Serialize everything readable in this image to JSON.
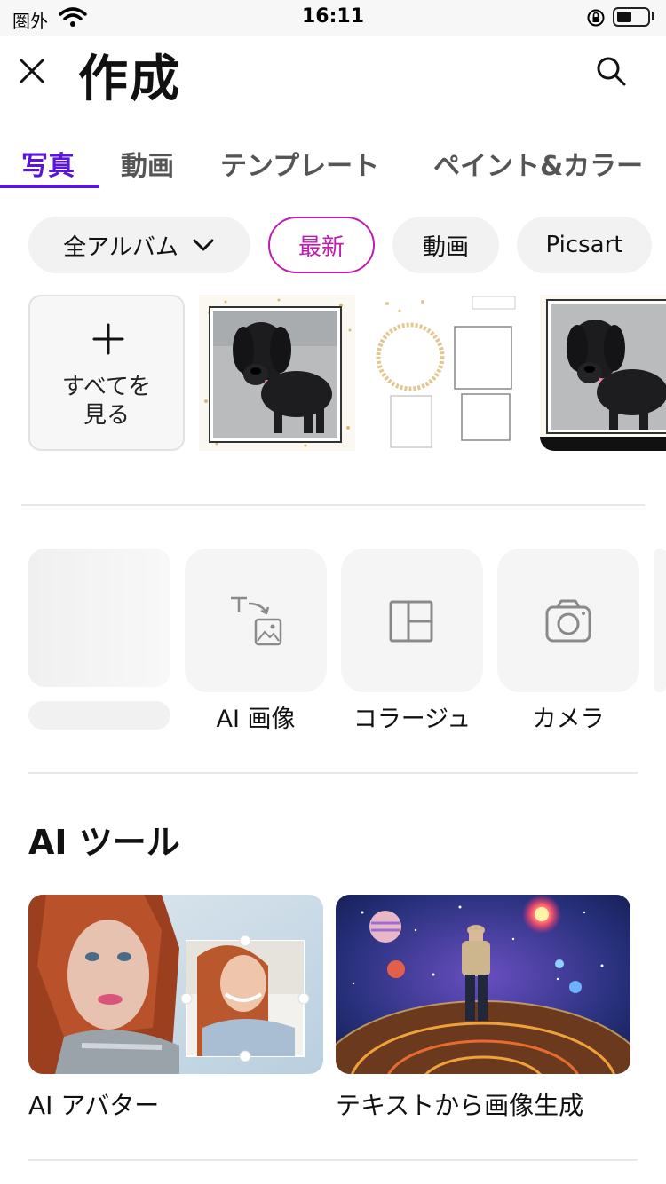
{
  "status": {
    "carrier": "圏外",
    "time": "16:11"
  },
  "header": {
    "title": "作成",
    "close_icon": "close-icon",
    "search_icon": "search-icon"
  },
  "tabs": [
    {
      "label": "写真",
      "active": true
    },
    {
      "label": "動画",
      "active": false
    },
    {
      "label": "テンプレート",
      "active": false
    },
    {
      "label": "ペイント&カラー",
      "active": false
    }
  ],
  "filters": [
    {
      "label": "全アルバム",
      "has_chevron": true,
      "selected": false
    },
    {
      "label": "最新",
      "selected": true
    },
    {
      "label": "動画",
      "selected": false
    },
    {
      "label": "Picsart",
      "selected": false
    }
  ],
  "recent": {
    "see_all_line1": "すべてを",
    "see_all_line2": "見る"
  },
  "create_tools": [
    {
      "label": "",
      "icon": "loading-placeholder"
    },
    {
      "label": "AI 画像",
      "icon": "text-to-image-icon"
    },
    {
      "label": "コラージュ",
      "icon": "collage-icon"
    },
    {
      "label": "カメラ",
      "icon": "camera-icon"
    }
  ],
  "ai_tools": {
    "title": "AI ツール",
    "items": [
      {
        "label": "AI アバター"
      },
      {
        "label": "テキストから画像生成"
      }
    ]
  },
  "colors": {
    "accent": "#5a15d9",
    "chip_selected": "#c21bb0"
  }
}
